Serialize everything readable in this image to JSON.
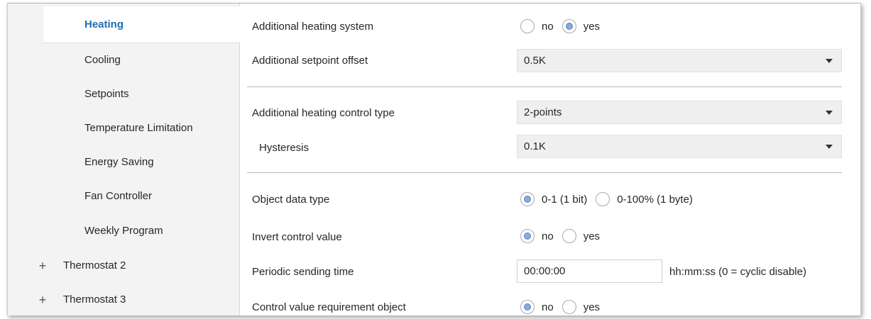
{
  "sidebar": {
    "items": [
      {
        "label": "Heating",
        "selected": true
      },
      {
        "label": "Cooling"
      },
      {
        "label": "Setpoints"
      },
      {
        "label": "Temperature Limitation"
      },
      {
        "label": "Energy Saving"
      },
      {
        "label": "Fan Controller"
      },
      {
        "label": "Weekly Program"
      },
      {
        "label": "Thermostat 2",
        "expand": "+"
      },
      {
        "label": "Thermostat 3",
        "expand": "+"
      }
    ]
  },
  "params": {
    "additional_heating": {
      "label": "Additional heating system",
      "options": [
        "no",
        "yes"
      ],
      "selected": "yes"
    },
    "setpoint_offset": {
      "label": "Additional setpoint offset",
      "value": "0.5K"
    },
    "control_type": {
      "label": "Additional heating control type",
      "value": "2-points"
    },
    "hysteresis": {
      "label": "Hysteresis",
      "value": "0.1K"
    },
    "object_data_type": {
      "label": "Object data type",
      "options": [
        "0-1 (1 bit)",
        "0-100% (1 byte)"
      ],
      "selected": "0-1 (1 bit)"
    },
    "invert_control": {
      "label": "Invert control value",
      "options": [
        "no",
        "yes"
      ],
      "selected": "no"
    },
    "periodic_sending": {
      "label": "Periodic sending time",
      "value": "00:00:00",
      "hint": "hh:mm:ss (0 = cyclic disable)"
    },
    "control_requirement": {
      "label": "Control value requirement object",
      "options": [
        "no",
        "yes"
      ],
      "selected": "no"
    }
  },
  "colors": {
    "selected_text": "#1f6eb4",
    "radio_fill": "#8eaadb"
  }
}
